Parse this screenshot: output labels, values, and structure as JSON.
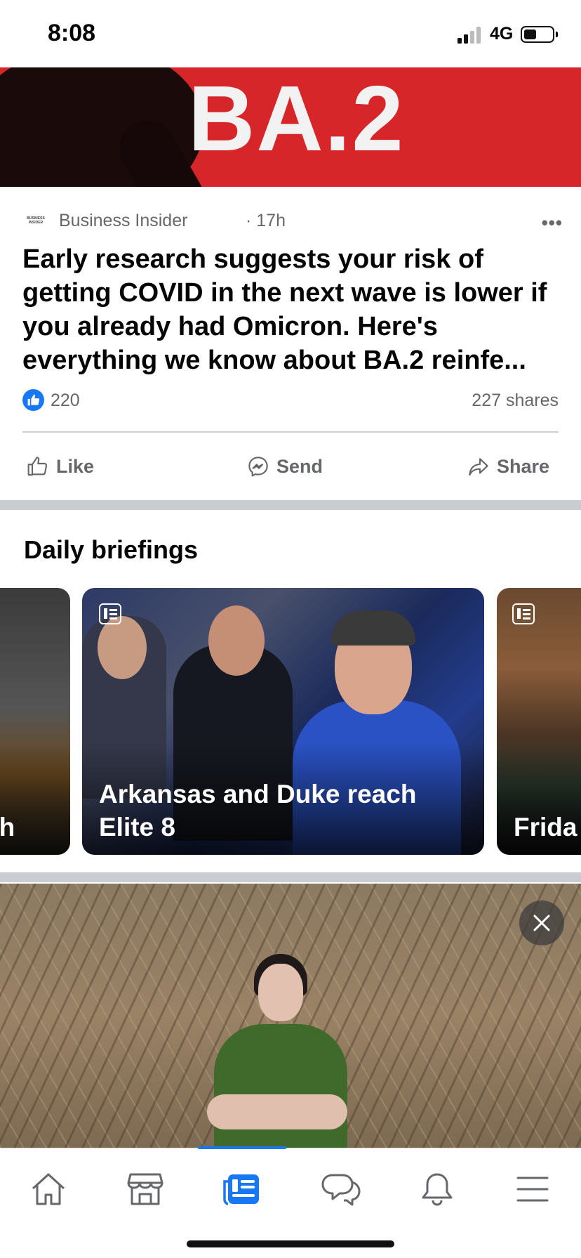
{
  "status_bar": {
    "time": "8:08",
    "network": "4G"
  },
  "hero": {
    "text": "BA.2"
  },
  "post": {
    "source": "Business Insider",
    "source_logo_text": "BUSINESS INSIDER",
    "time": "17h",
    "more_icon": "more-dots-icon",
    "headline": "Early research suggests your risk of getting COVID in the next wave is lower if you already had Omicron. Here's everything we know about BA.2 reinfe...",
    "reaction_count": "220",
    "shares": "227 shares",
    "actions": {
      "like": "Like",
      "send": "Send",
      "share": "Share"
    }
  },
  "daily_briefings": {
    "title": "Daily briefings",
    "cards": [
      {
        "title": "gh"
      },
      {
        "title": "Arkansas and Duke reach Elite 8"
      },
      {
        "title": "Frida"
      }
    ]
  },
  "bottom_nav": {
    "items": [
      "home-icon",
      "marketplace-icon",
      "news-icon",
      "messages-icon",
      "notifications-icon",
      "menu-icon"
    ],
    "active": "news-icon"
  },
  "colors": {
    "accent": "#1877f2",
    "hero_red": "#d6262a",
    "text_secondary": "#65676b"
  }
}
